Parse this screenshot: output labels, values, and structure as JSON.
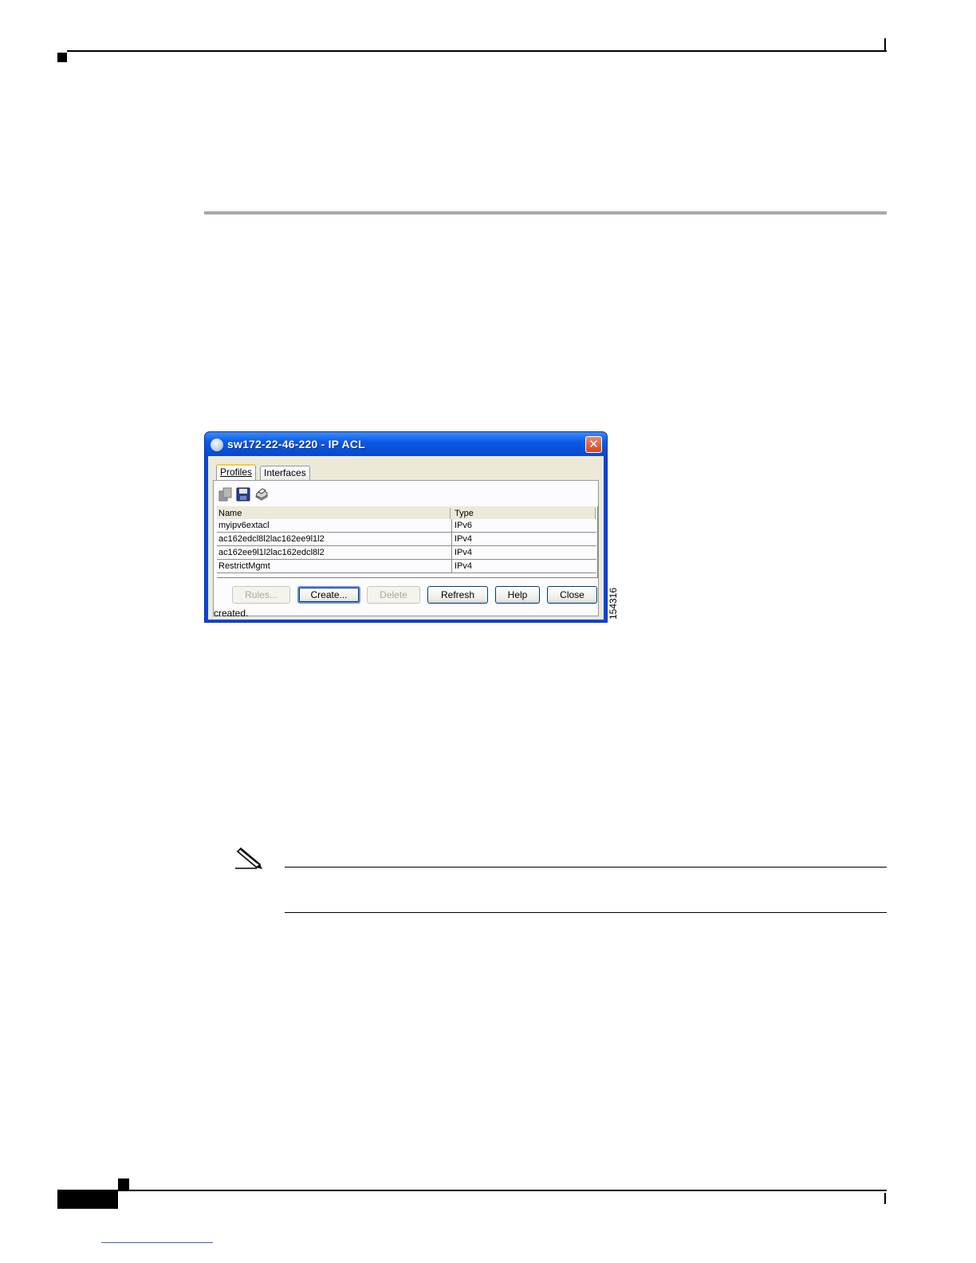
{
  "figure": {
    "id": "154316"
  },
  "window": {
    "title": "sw172-22-46-220 - IP ACL",
    "close_glyph": "✕",
    "tabs": [
      {
        "label": "Profiles",
        "selected": true
      },
      {
        "label": "Interfaces",
        "selected": false
      }
    ],
    "toolbar": [
      {
        "icon": "copy-icon"
      },
      {
        "icon": "save-icon"
      },
      {
        "icon": "print-icon"
      }
    ],
    "table": {
      "columns": [
        "Name",
        "Type"
      ],
      "rows": [
        {
          "name": "myipv6extacl",
          "type": "IPv6"
        },
        {
          "name": "ac162edcl8l2lac162ee9l1l2",
          "type": "IPv4"
        },
        {
          "name": "ac162ee9l1l2lac162edcl8l2",
          "type": "IPv4"
        },
        {
          "name": "RestrictMgmt",
          "type": "IPv4"
        }
      ]
    },
    "buttons": {
      "rules": "Rules...",
      "create": "Create...",
      "delete": "Delete",
      "refresh": "Refresh",
      "help": "Help",
      "close": "Close"
    },
    "status": "created."
  },
  "colors": {
    "title_bar": "#0b5be8",
    "dialog_face": "#ece9d8",
    "section_rule": "#a8a8a8"
  }
}
